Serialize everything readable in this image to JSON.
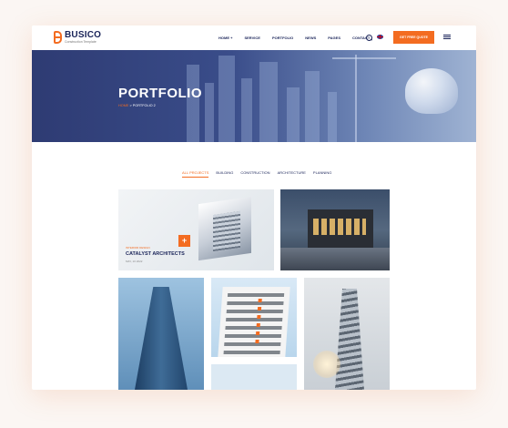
{
  "header": {
    "logo_name": "BUSICO",
    "logo_tagline": "Construction Template",
    "nav": [
      "HOME +",
      "SERVICE",
      "PORTFOLIO",
      "NEWS",
      "PAGES",
      "CONTACT"
    ],
    "cta_label": "GET FREE QUOTE"
  },
  "hero": {
    "title": "PORTFOLIO",
    "breadcrumb_home": "HOME",
    "breadcrumb_sep": ">",
    "breadcrumb_current": "PORTFOLIO 2"
  },
  "filters": [
    "ALL PROJECTS",
    "BUILDING",
    "CONSTRUCTION",
    "ARCHITECTURE",
    "PLANNING"
  ],
  "featured": {
    "category": "INTERIOR DESIGN",
    "title": "CATALYST ARCHITECTS",
    "date": "MAY, 10 2022",
    "plus": "+"
  },
  "colors": {
    "accent": "#f36c21",
    "navy": "#1a2459"
  }
}
